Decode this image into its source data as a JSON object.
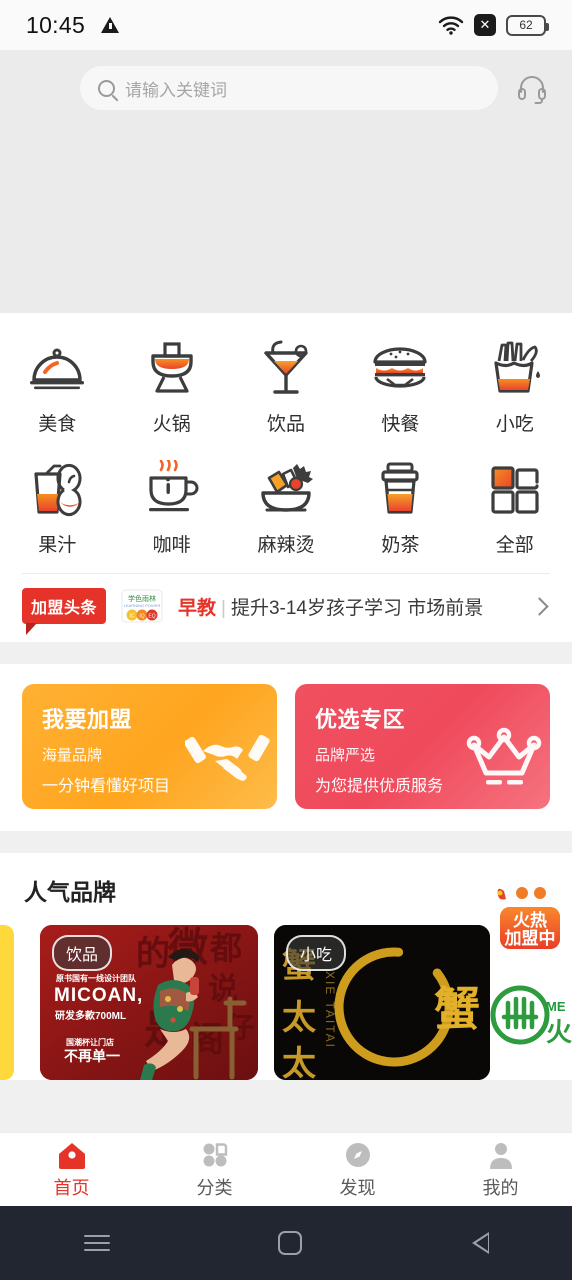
{
  "status_bar": {
    "time": "10:45",
    "warning_icon": "warning-triangle-icon",
    "wifi_icon": "wifi-icon",
    "signal_icon": "no-signal-x-icon",
    "battery_level": "62"
  },
  "search": {
    "placeholder": "请输入关键词",
    "search_icon": "search-icon",
    "service_icon": "headset-icon"
  },
  "categories": [
    {
      "label": "美食",
      "icon": "cloche-icon"
    },
    {
      "label": "火锅",
      "icon": "hotpot-icon"
    },
    {
      "label": "饮品",
      "icon": "cocktail-icon"
    },
    {
      "label": "快餐",
      "icon": "burger-icon"
    },
    {
      "label": "小吃",
      "icon": "fries-icon"
    },
    {
      "label": "果汁",
      "icon": "juice-apple-icon"
    },
    {
      "label": "咖啡",
      "icon": "coffee-cup-icon"
    },
    {
      "label": "麻辣烫",
      "icon": "spicy-bowl-icon"
    },
    {
      "label": "奶茶",
      "icon": "milk-tea-icon"
    },
    {
      "label": "全部",
      "icon": "grid-all-icon"
    }
  ],
  "news_ticker": {
    "badge": "加盟头条",
    "thumb_icon": "brand-thumb-icon",
    "tag": "早教",
    "separator": "|",
    "headline": "提升3-14岁孩子学习 市场前景",
    "arrow_icon": "chevron-right-icon"
  },
  "promos": [
    {
      "title": "我要加盟",
      "line1": "海量品牌",
      "line2": "一分钟看懂好项目",
      "icon": "handshake-icon",
      "color": "#ffa51f"
    },
    {
      "title": "优选专区",
      "line1": "品牌严选",
      "line2": "为您提供优质服务",
      "icon": "crown-icon",
      "color": "#ef4a5c"
    }
  ],
  "popular_brands": {
    "title": "人气品牌",
    "hot_badge": {
      "line1": "火热",
      "line2": "加盟中"
    },
    "cards": [
      {
        "tag": "饮品",
        "brand": "MICOAN,",
        "caption1": "原书国有一线设计团队",
        "caption2": "研发多款700ML",
        "caption3": "国潮杯让门店",
        "caption4": "不再单一"
      },
      {
        "tag": "小吃",
        "brand_cn": "蟹太太",
        "brand_en": "XIE TAITAI",
        "logo_char": "蟹"
      },
      {
        "logo_text": "ME"
      }
    ]
  },
  "tabbar": [
    {
      "label": "首页",
      "icon": "home-icon",
      "active": true
    },
    {
      "label": "分类",
      "icon": "grid-icon",
      "active": false
    },
    {
      "label": "发现",
      "icon": "compass-icon",
      "active": false
    },
    {
      "label": "我的",
      "icon": "person-icon",
      "active": false
    }
  ],
  "android_nav": {
    "menu_icon": "menu-icon",
    "home_icon": "home-square-icon",
    "back_icon": "back-triangle-icon"
  },
  "theme": {
    "accent_red": "#e5332a",
    "accent_orange": "#f26522",
    "icon_gray": "#3d3d3d",
    "page_bg": "#f0f0f0"
  }
}
